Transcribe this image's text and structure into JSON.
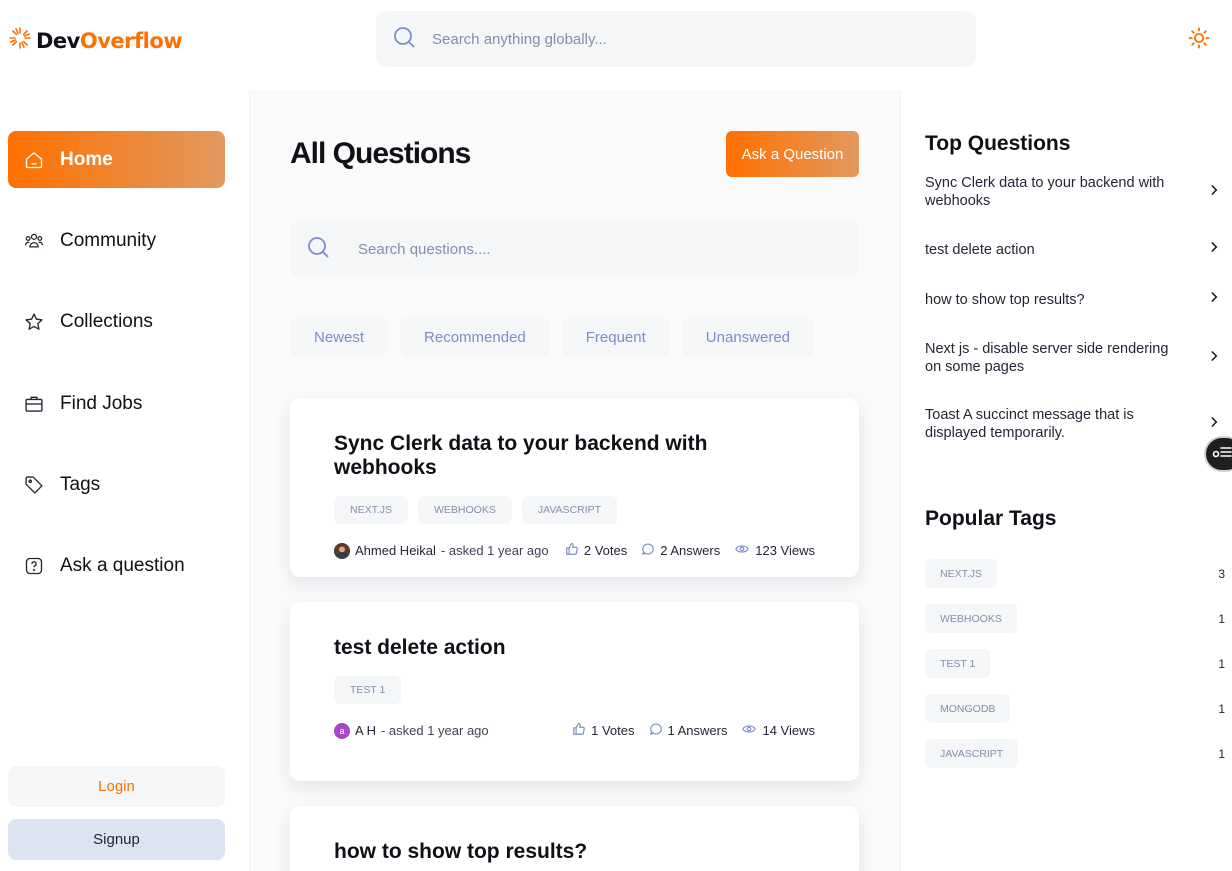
{
  "navbar": {
    "logo_dev": "Dev",
    "logo_overflow": "Overflow",
    "search_placeholder": "Search anything globally...",
    "theme_icon": "sun-icon"
  },
  "sidebar": {
    "items": [
      {
        "label": "Home",
        "icon": "home-icon",
        "active": true
      },
      {
        "label": "Community",
        "icon": "users-icon"
      },
      {
        "label": "Collections",
        "icon": "star-icon"
      },
      {
        "label": "Find Jobs",
        "icon": "briefcase-icon"
      },
      {
        "label": "Tags",
        "icon": "tag-icon"
      },
      {
        "label": "Ask a question",
        "icon": "question-icon"
      }
    ],
    "login_label": "Login",
    "signup_label": "Signup"
  },
  "main": {
    "title": "All Questions",
    "ask_button": "Ask a Question",
    "search_placeholder": "Search questions....",
    "filters": [
      "Newest",
      "Recommended",
      "Frequent",
      "Unanswered"
    ],
    "questions": [
      {
        "title": "Sync Clerk data to your backend with webhooks",
        "tags": [
          "NEXT.JS",
          "WEBHOOKS",
          "JAVASCRIPT"
        ],
        "author": "Ahmed Heikal",
        "asked": "- asked 1 year ago",
        "votes": "2 Votes",
        "answers": "2 Answers",
        "views": "123 Views"
      },
      {
        "title": "test delete action",
        "tags": [
          "TEST 1"
        ],
        "author": "A H",
        "avatar_letter": "a",
        "asked": "- asked 1 year ago",
        "votes": "1 Votes",
        "answers": "1 Answers",
        "views": "14 Views"
      },
      {
        "title": "how to show top results?"
      }
    ]
  },
  "rightbar": {
    "top_questions_heading": "Top Questions",
    "top_questions": [
      "Sync Clerk data to your backend with webhooks",
      "test delete action",
      "how to show top results?",
      "Next js - disable server side rendering on some pages",
      "Toast A succinct message that is displayed temporarily."
    ],
    "popular_tags_heading": "Popular Tags",
    "popular_tags": [
      {
        "name": "NEXT.JS",
        "count": "3"
      },
      {
        "name": "WEBHOOKS",
        "count": "1"
      },
      {
        "name": "TEST 1",
        "count": "1"
      },
      {
        "name": "MONGODB",
        "count": "1"
      },
      {
        "name": "JAVASCRIPT",
        "count": "1"
      }
    ]
  },
  "colors": {
    "accent": "#ff7000",
    "accent_gradient_end": "#e2995f",
    "chip_bg": "#f4f6f8",
    "muted_text": "#858ead",
    "signup_bg": "#dce3f1"
  }
}
